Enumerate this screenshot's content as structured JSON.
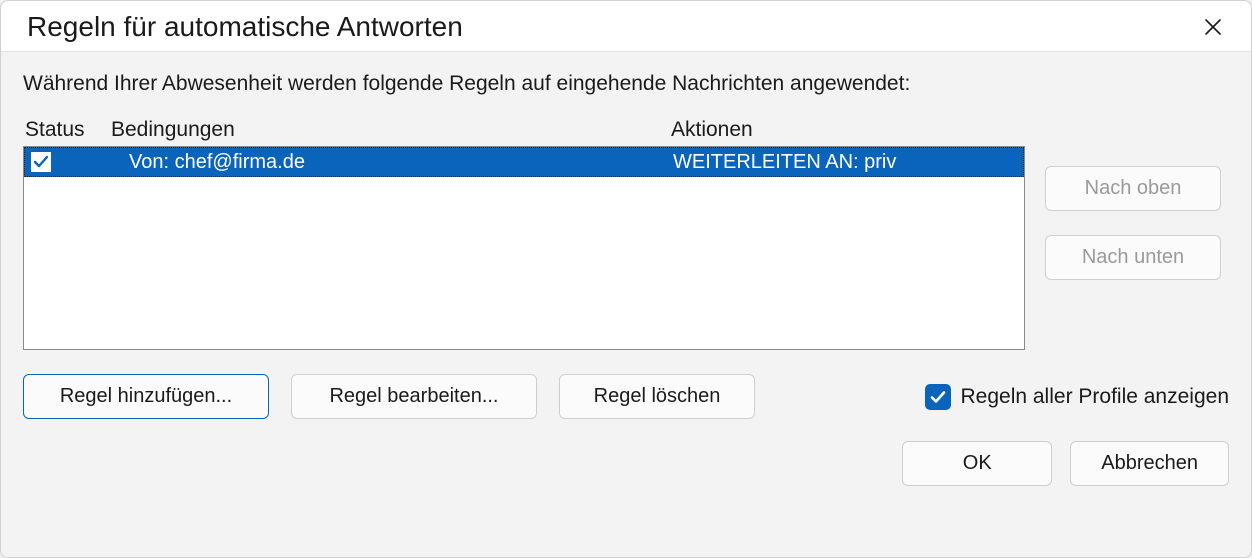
{
  "dialog": {
    "title": "Regeln für automatische Antworten",
    "description": "Während Ihrer Abwesenheit werden folgende Regeln auf eingehende Nachrichten angewendet:"
  },
  "columns": {
    "status": "Status",
    "conditions": "Bedingungen",
    "actions": "Aktionen"
  },
  "rules": [
    {
      "status_checked": true,
      "condition": "Von: chef@firma.de",
      "action": "WEITERLEITEN AN: priv",
      "selected": true
    }
  ],
  "side_buttons": {
    "move_up": "Nach oben",
    "move_down": "Nach unten"
  },
  "bottom_buttons": {
    "add_rule": "Regel hinzufügen...",
    "edit_rule": "Regel bearbeiten...",
    "delete_rule": "Regel löschen"
  },
  "checkbox": {
    "show_all_profiles_label": "Regeln aller Profile anzeigen",
    "checked": true
  },
  "footer": {
    "ok": "OK",
    "cancel": "Abbrechen"
  }
}
